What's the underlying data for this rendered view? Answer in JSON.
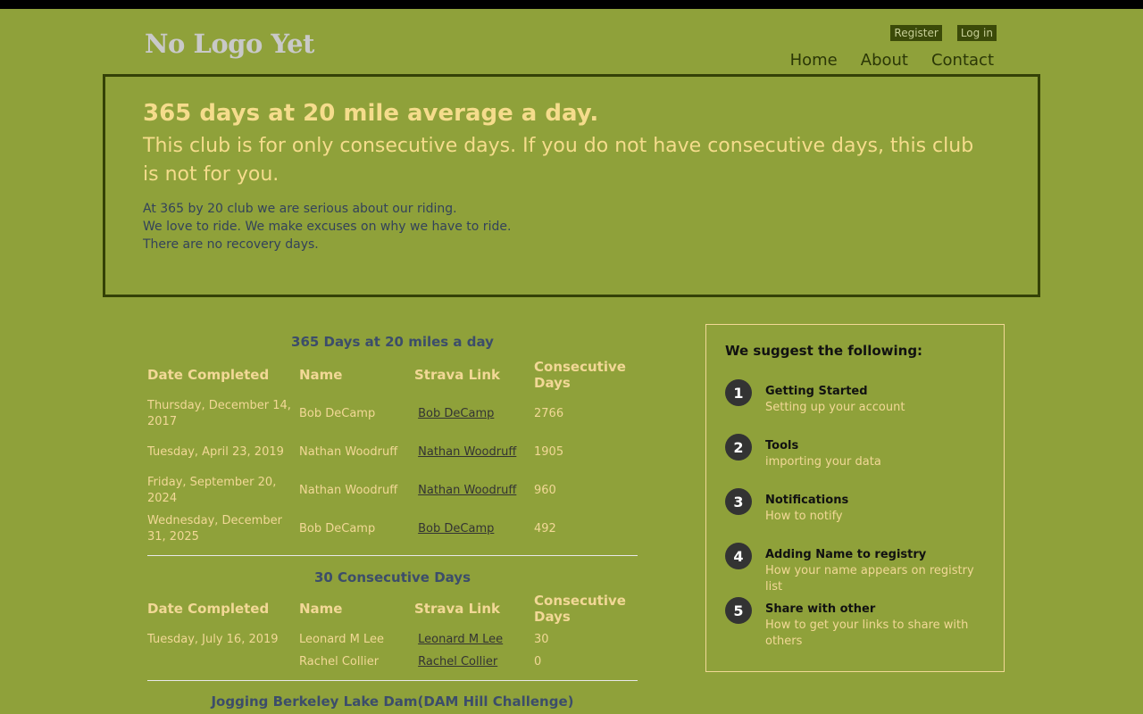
{
  "header": {
    "logo": "No Logo Yet",
    "register": "Register",
    "login": "Log in",
    "nav": [
      "Home",
      "About",
      "Contact"
    ]
  },
  "hero": {
    "title": "365 days at 20 mile average a day.",
    "subtitle": "This club is for only consecutive days. If you do not have consecutive days, this club is not for you.",
    "lines": [
      "At 365 by 20 club we are serious about our riding.",
      "We love to ride. We make excuses on why we have to ride.",
      "There are no recovery days."
    ]
  },
  "tables": {
    "columns": [
      "Date Completed",
      "Name",
      "Strava Link",
      "Consecutive Days"
    ],
    "sections": [
      {
        "title": "365 Days at 20 miles a day",
        "rows": [
          {
            "date": "Thursday, December 14, 2017",
            "name": "Bob DeCamp",
            "link": "Bob DeCamp",
            "days": "2766"
          },
          {
            "date": "Tuesday, April 23, 2019",
            "name": "Nathan Woodruff",
            "link": "Nathan Woodruff",
            "days": "1905"
          },
          {
            "date": "Friday, September 20, 2024",
            "name": "Nathan Woodruff",
            "link": "Nathan Woodruff",
            "days": "960"
          },
          {
            "date": "Wednesday, December 31, 2025",
            "name": "Bob DeCamp",
            "link": "Bob DeCamp",
            "days": "492"
          }
        ]
      },
      {
        "title": "30 Consecutive Days",
        "rows": [
          {
            "date": "Tuesday, July 16, 2019",
            "name": "Leonard M Lee",
            "link": "Leonard M Lee",
            "days": "30"
          },
          {
            "date": "",
            "name": "Rachel Collier",
            "link": "Rachel Collier",
            "days": "0"
          }
        ]
      },
      {
        "title": "Jogging Berkeley Lake Dam(DAM Hill Challenge)",
        "rows": []
      }
    ]
  },
  "suggest": {
    "title": "We suggest the following:",
    "steps": [
      {
        "num": "1",
        "title": "Getting Started",
        "desc": "Setting up your account"
      },
      {
        "num": "2",
        "title": "Tools",
        "desc": "importing your data"
      },
      {
        "num": "3",
        "title": "Notifications",
        "desc": "How to notify"
      },
      {
        "num": "4",
        "title": "Adding Name to registry",
        "desc": "How your name appears on registry list"
      },
      {
        "num": "5",
        "title": "Share with other",
        "desc": "How to get your links to share with others"
      }
    ]
  }
}
